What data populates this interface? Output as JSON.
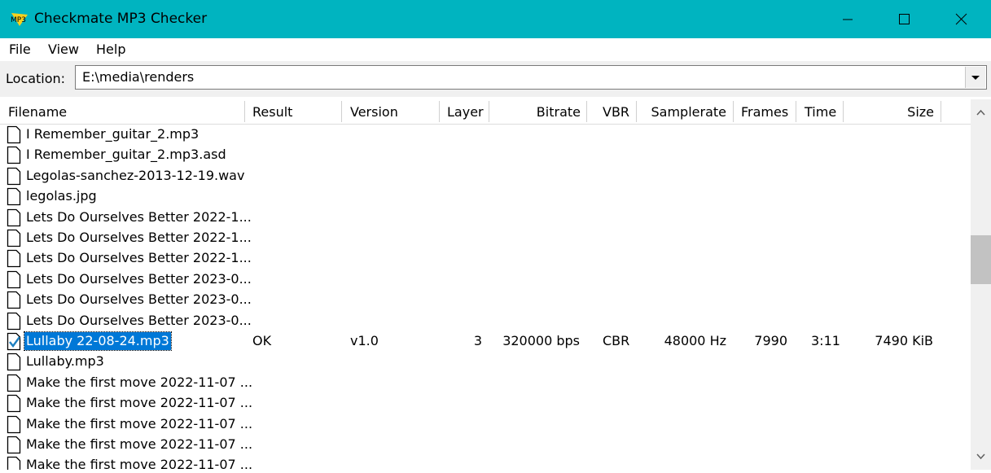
{
  "window": {
    "title": "Checkmate MP3 Checker",
    "icon_text": "MP3",
    "accent_color": "#00b4c0"
  },
  "menu": [
    "File",
    "View",
    "Help"
  ],
  "location": {
    "label": "Location:",
    "value": "E:\\media\\renders"
  },
  "columns": [
    "Filename",
    "Result",
    "Version",
    "Layer",
    "Bitrate",
    "VBR",
    "Samplerate",
    "Frames",
    "Time",
    "Size"
  ],
  "rows": [
    {
      "filename": "I Remember_guitar_2.mp3"
    },
    {
      "filename": "I Remember_guitar_2.mp3.asd"
    },
    {
      "filename": "Legolas-sanchez-2013-12-19.wav"
    },
    {
      "filename": "legolas.jpg"
    },
    {
      "filename": "Lets Do Ourselves Better 2022-1..."
    },
    {
      "filename": "Lets Do Ourselves Better 2022-1..."
    },
    {
      "filename": "Lets Do Ourselves Better 2022-1..."
    },
    {
      "filename": "Lets Do Ourselves Better 2023-0..."
    },
    {
      "filename": "Lets Do Ourselves Better 2023-0..."
    },
    {
      "filename": "Lets Do Ourselves Better 2023-0..."
    },
    {
      "filename": "Lullaby 22-08-24.mp3",
      "selected": true,
      "checked": true,
      "result": "OK",
      "version": "v1.0",
      "layer": "3",
      "bitrate": "320000 bps",
      "vbr": "CBR",
      "samplerate": "48000 Hz",
      "frames": "7990",
      "time": "3:11",
      "size": "7490 KiB"
    },
    {
      "filename": "Lullaby.mp3"
    },
    {
      "filename": "Make the first move 2022-11-07 ..."
    },
    {
      "filename": "Make the first move 2022-11-07 ..."
    },
    {
      "filename": "Make the first move 2022-11-07 ..."
    },
    {
      "filename": "Make the first move 2022-11-07 ..."
    },
    {
      "filename": "Make the first move 2022-11-07 ..."
    }
  ]
}
